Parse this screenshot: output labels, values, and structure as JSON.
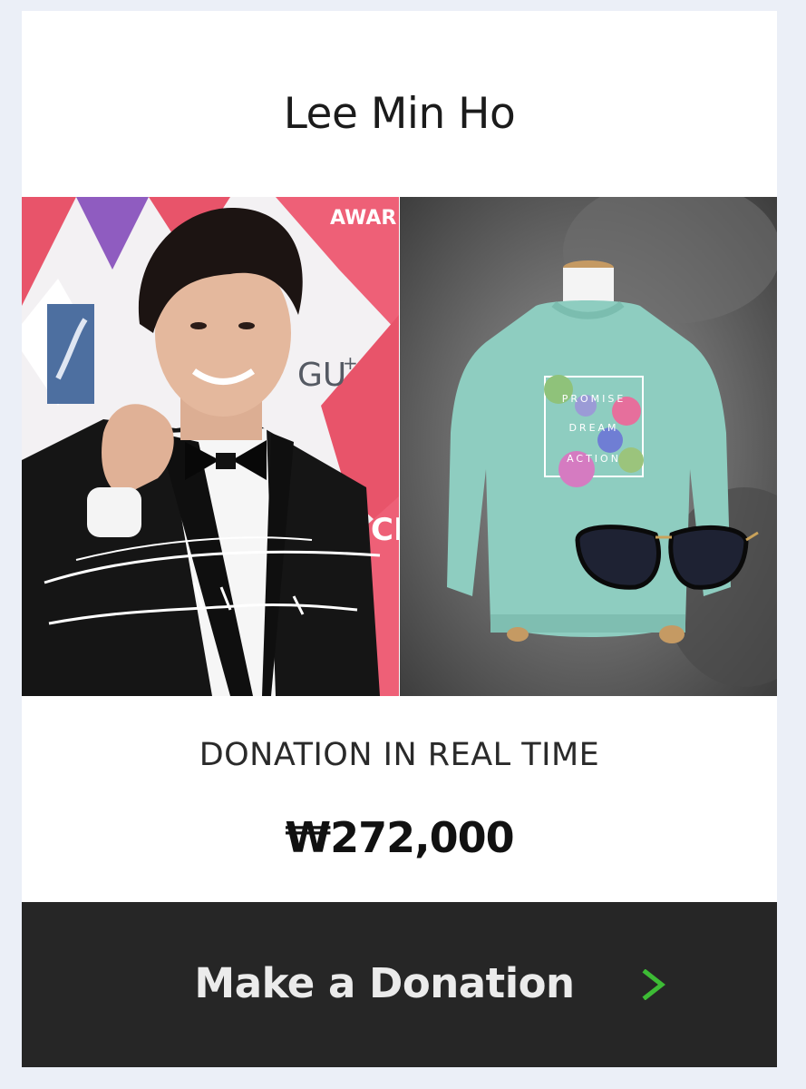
{
  "campaign": {
    "title": "Lee Min Ho"
  },
  "photos": {
    "left": {
      "alt": "Lee Min Ho at awards red carpet",
      "icon": "portrait-photo"
    },
    "right": {
      "alt": "Mint sweatshirt with sunglasses",
      "icon": "product-photo"
    }
  },
  "donation": {
    "label": "DONATION IN REAL TIME",
    "amount": "₩272,000"
  },
  "cta": {
    "label": "Make a Donation",
    "arrow_icon": "chevron-right-icon",
    "arrow_color": "#3dbb35"
  },
  "colors": {
    "page_bg": "#ebeff7",
    "card_bg": "#ffffff",
    "cta_bg": "#262626",
    "sweatshirt": "#8ecdc0"
  }
}
